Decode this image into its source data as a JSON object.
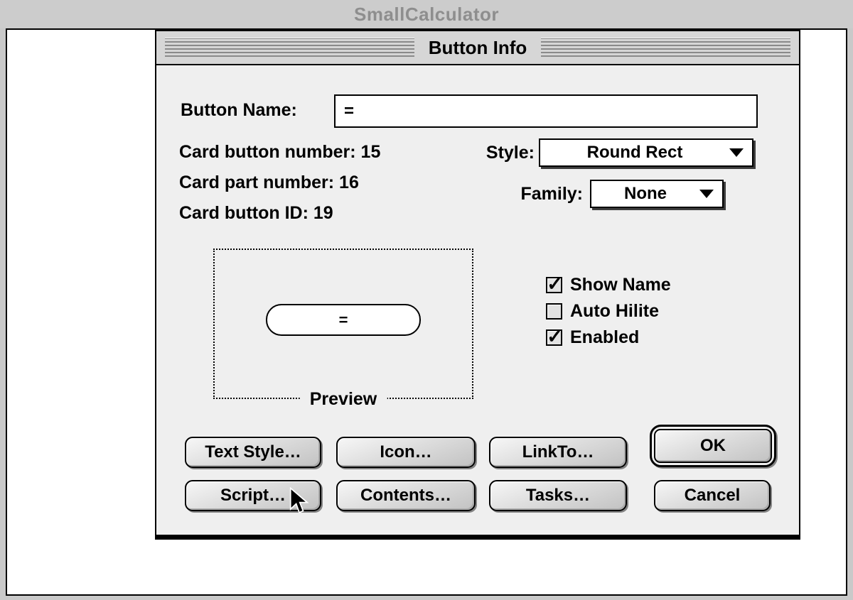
{
  "window": {
    "title": "SmallCalculator"
  },
  "dialog": {
    "title": "Button Info",
    "name_field": {
      "label": "Button Name:",
      "value": "="
    },
    "info": [
      {
        "label": "Card button number:",
        "value": "15"
      },
      {
        "label": "Card part number:",
        "value": "16"
      },
      {
        "label": "Card button ID:",
        "value": "19"
      }
    ],
    "style_dropdown": {
      "label": "Style:",
      "value": "Round Rect"
    },
    "family_dropdown": {
      "label": "Family:",
      "value": "None"
    },
    "preview": {
      "caption": "Preview",
      "button_label": "="
    },
    "checkboxes": [
      {
        "label": "Show Name",
        "checked": true
      },
      {
        "label": "Auto Hilite",
        "checked": false
      },
      {
        "label": "Enabled",
        "checked": true
      }
    ],
    "actions": {
      "text_style": "Text Style…",
      "icon": "Icon…",
      "link_to": "LinkTo…",
      "script": "Script…",
      "contents": "Contents…",
      "tasks": "Tasks…",
      "ok": "OK",
      "cancel": "Cancel"
    }
  },
  "icons": {
    "check": "✓"
  },
  "colors": {
    "titlebar_bg": "#cccccc",
    "dialog_titlebar_bg": "#d6d6d6",
    "dialog_bg": "#efefef",
    "window_bg": "#ffffff",
    "border": "#000000",
    "inactive_title": "#8e8e8e",
    "stripe": "#8a8a8a",
    "checkbox_fill": "#e2e2e2"
  }
}
